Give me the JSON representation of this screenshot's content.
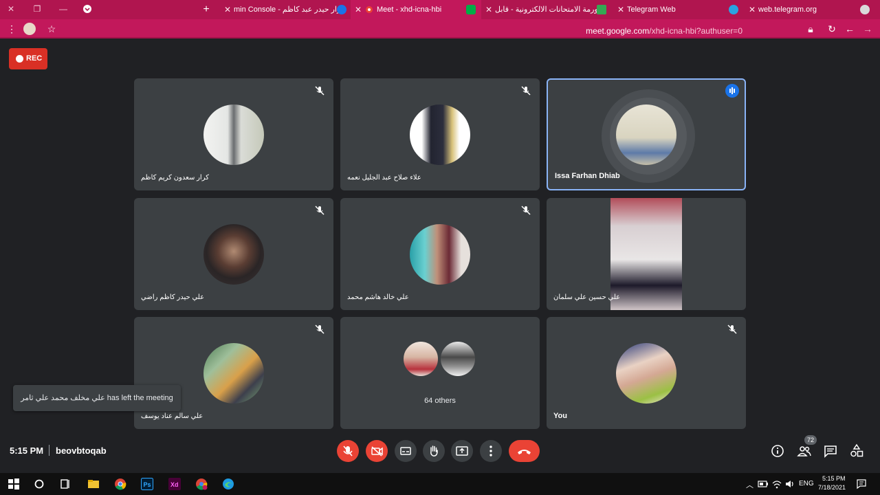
{
  "browser": {
    "tabs": [
      {
        "label": "web.telegram.org",
        "active": false
      },
      {
        "label": "Telegram Web",
        "active": false
      },
      {
        "label": "فورمة الامتحانات الالكترونية - قابل",
        "active": false
      },
      {
        "label": "Meet - xhd-icna-hbi",
        "active": true
      },
      {
        "label": "min Console - كرار حيدر عبد كاظم",
        "active": false
      }
    ],
    "url_domain": "meet.google.com",
    "url_path": "/xhd-icna-hbi?authuser=0"
  },
  "meet": {
    "rec_label": "REC",
    "tiles": [
      {
        "name": "كرار سعدون كريم كاظم"
      },
      {
        "name": "علاء صلاح عبد الجليل نعمه"
      },
      {
        "name": "Issa Farhan Dhiab"
      },
      {
        "name": "علي حيدر كاظم راضي"
      },
      {
        "name": "علي خالد هاشم محمد"
      },
      {
        "name": "علي حسين علي سلمان"
      },
      {
        "name": "علي سالم عناد يوسف"
      },
      {
        "name": "64 others"
      },
      {
        "name": "You"
      }
    ],
    "toast": "علي مخلف محمد علي ثامر has left the meeting",
    "clock": "5:15 PM",
    "meeting_code": "beovbtoqab",
    "participants_count": "72"
  },
  "taskbar": {
    "lang": "ENG",
    "time": "5:15 PM",
    "date": "7/18/2021"
  },
  "colors": {
    "chrome_bg": "#c2185b",
    "meet_bg": "#202124",
    "tile_bg": "#3c4043",
    "danger": "#ea4335",
    "speaking_border": "#8ab4f8"
  }
}
